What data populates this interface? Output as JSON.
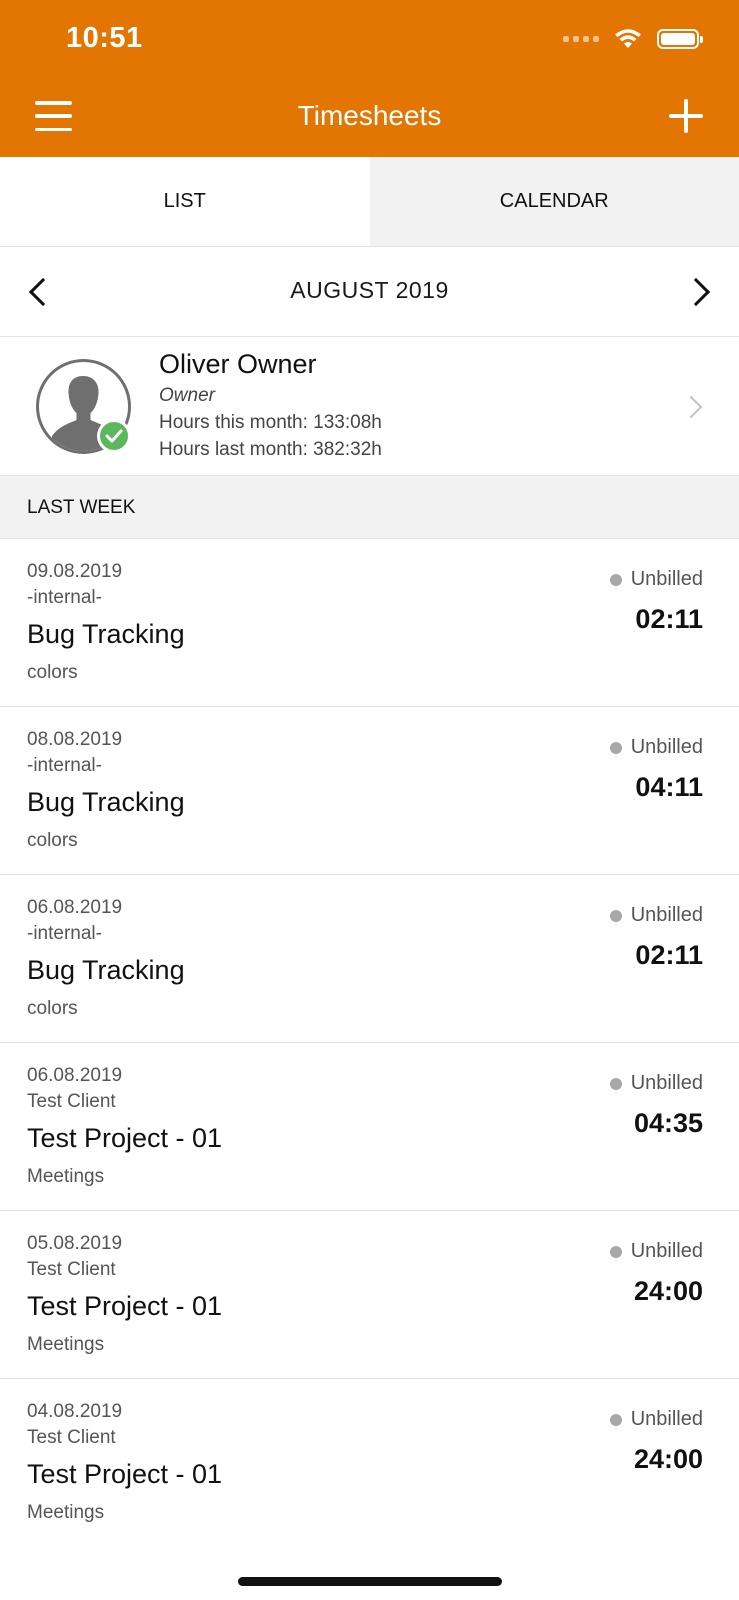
{
  "status_bar": {
    "time": "10:51"
  },
  "header": {
    "title": "Timesheets"
  },
  "tabs": [
    {
      "label": "LIST"
    },
    {
      "label": "CALENDAR"
    }
  ],
  "month_nav": {
    "label": "AUGUST 2019"
  },
  "user": {
    "name": "Oliver Owner",
    "role": "Owner",
    "hours_this_month": "Hours this month: 133:08h",
    "hours_last_month": "Hours last month: 382:32h"
  },
  "section": {
    "title": "LAST WEEK"
  },
  "entries": [
    {
      "date": "09.08.2019",
      "client": "-internal-",
      "project": "Bug Tracking",
      "task": "colors",
      "status": "Unbilled",
      "duration": "02:11"
    },
    {
      "date": "08.08.2019",
      "client": "-internal-",
      "project": "Bug Tracking",
      "task": "colors",
      "status": "Unbilled",
      "duration": "04:11"
    },
    {
      "date": "06.08.2019",
      "client": "-internal-",
      "project": "Bug Tracking",
      "task": "colors",
      "status": "Unbilled",
      "duration": "02:11"
    },
    {
      "date": "06.08.2019",
      "client": "Test Client",
      "project": "Test Project - 01",
      "task": "Meetings",
      "status": "Unbilled",
      "duration": "04:35"
    },
    {
      "date": "05.08.2019",
      "client": "Test Client",
      "project": "Test Project - 01",
      "task": "Meetings",
      "status": "Unbilled",
      "duration": "24:00"
    },
    {
      "date": "04.08.2019",
      "client": "Test Client",
      "project": "Test Project - 01",
      "task": "Meetings",
      "status": "Unbilled",
      "duration": "24:00"
    }
  ],
  "colors": {
    "accent": "#E37503",
    "status_dot": "#A8A8A8",
    "badge": "#5CB85C"
  }
}
